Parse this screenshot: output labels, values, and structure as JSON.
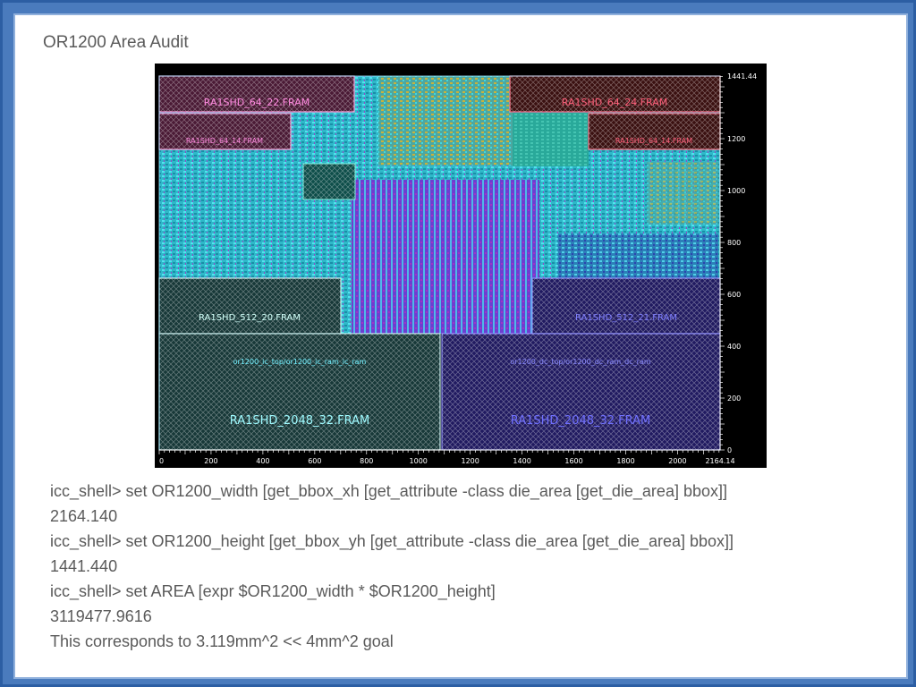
{
  "title": "OR1200 Area Audit",
  "layout_plot": {
    "x_ticks": [
      "0",
      "200",
      "400",
      "600",
      "800",
      "1000",
      "1200",
      "1400",
      "1600",
      "1800",
      "2000",
      "2164.14"
    ],
    "y_ticks": [
      "0",
      "200",
      "400",
      "600",
      "800",
      "1000",
      "1200",
      "1441.44"
    ],
    "blocks": {
      "b1": {
        "label": "RA1SHD_64_22.FRAM"
      },
      "b2": {
        "label": "RA1SHD_64_24.FRAM"
      },
      "b3": {
        "label": "RA1SHD_64_14.FRAM"
      },
      "b4": {
        "label": "RA1SHD_64_14.FRAM"
      },
      "b5": {
        "label": "RA1SHD_512_20.FRAM"
      },
      "b6": {
        "label": "RA1SHD_512_21.FRAM"
      },
      "b7": {
        "label": "RA1SHD_2048_32.FRAM",
        "instance": "or1200_ic_top/or1200_ic_ram_ic_ram"
      },
      "b8": {
        "label": "RA1SHD_2048_32.FRAM",
        "instance": "or1200_dc_top/or1200_dc_ram_dc_ram"
      }
    }
  },
  "console": {
    "lines": [
      "icc_shell> set OR1200_width [get_bbox_xh [get_attribute -class die_area [get_die_area] bbox]]",
      "2164.140",
      "icc_shell> set OR1200_height [get_bbox_yh [get_attribute -class die_area [get_die_area] bbox]]",
      "1441.440",
      "icc_shell> set AREA [expr $OR1200_width * $OR1200_height]",
      "3119477.9616",
      "This corresponds to 3.119mm^2 << 4mm^2 goal"
    ]
  }
}
